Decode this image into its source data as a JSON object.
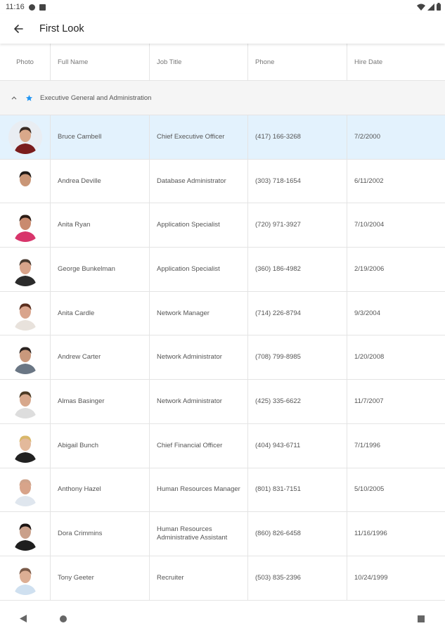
{
  "status": {
    "time": "11:16",
    "icons": [
      "signal-app-icon",
      "sim-icon",
      "wifi-icon",
      "cell-signal-icon",
      "battery-icon"
    ]
  },
  "appbar": {
    "back_icon": "arrow-left-icon",
    "title": "First Look"
  },
  "table": {
    "columns": [
      "Photo",
      "Full Name",
      "Job Title",
      "Phone",
      "Hire Date"
    ],
    "group": {
      "label": "Executive General and Administration",
      "icons": [
        "chevron-up-icon",
        "star-icon"
      ]
    },
    "rows": [
      {
        "name": "Bruce Cambell",
        "title": "Chief Executive Officer",
        "phone": "(417) 166-3268",
        "hire": "7/2/2000",
        "selected": true
      },
      {
        "name": "Andrea Deville",
        "title": "Database Administrator",
        "phone": "(303) 718-1654",
        "hire": "6/11/2002"
      },
      {
        "name": "Anita Ryan",
        "title": "Application Specialist",
        "phone": "(720) 971-3927",
        "hire": "7/10/2004"
      },
      {
        "name": "George Bunkelman",
        "title": "Application Specialist",
        "phone": "(360) 186-4982",
        "hire": "2/19/2006"
      },
      {
        "name": "Anita Cardle",
        "title": "Network Manager",
        "phone": "(714) 226-8794",
        "hire": "9/3/2004"
      },
      {
        "name": "Andrew Carter",
        "title": "Network Administrator",
        "phone": "(708) 799-8985",
        "hire": "1/20/2008"
      },
      {
        "name": "Almas Basinger",
        "title": "Network Administrator",
        "phone": "(425) 335-6622",
        "hire": "11/7/2007"
      },
      {
        "name": "Abigail Bunch",
        "title": "Chief Financial Officer",
        "phone": "(404) 943-6711",
        "hire": "7/1/1996"
      },
      {
        "name": "Anthony Hazel",
        "title": "Human Resources Manager",
        "phone": "(801) 831-7151",
        "hire": "5/10/2005"
      },
      {
        "name": "Dora Crimmins",
        "title": "Human Resources Administrative Assistant",
        "phone": "(860) 826-6458",
        "hire": "11/16/1996"
      },
      {
        "name": "Tony Geeter",
        "title": "Recruiter",
        "phone": "(503) 835-2396",
        "hire": "10/24/1999"
      }
    ]
  },
  "navbar": {
    "icons": [
      "nav-back-icon",
      "nav-home-icon",
      "nav-recents-icon"
    ]
  },
  "colors": {
    "selected_row": "#e3f2fd",
    "group_bg": "#f5f5f5",
    "accent": "#2196f3"
  }
}
